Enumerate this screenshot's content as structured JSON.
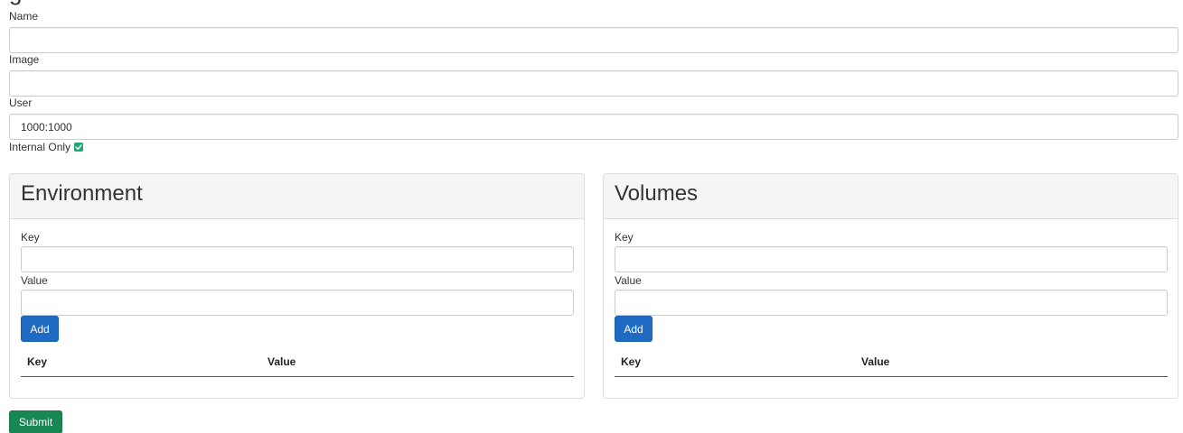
{
  "header": {
    "title": "g"
  },
  "form": {
    "name_label": "Name",
    "name_value": "",
    "image_label": "Image",
    "image_value": "",
    "user_label": "User",
    "user_value": "1000:1000",
    "internal_only_label": "Internal Only",
    "internal_only_checked": true
  },
  "environment": {
    "title": "Environment",
    "key_label": "Key",
    "key_value": "",
    "value_label": "Value",
    "value_value": "",
    "add_label": "Add",
    "columns": [
      "Key",
      "Value"
    ],
    "rows": []
  },
  "volumes": {
    "title": "Volumes",
    "key_label": "Key",
    "key_value": "",
    "value_label": "Value",
    "value_value": "",
    "add_label": "Add",
    "columns": [
      "Key",
      "Value"
    ],
    "rows": []
  },
  "submit_label": "Submit",
  "colors": {
    "primary": "#1f6bc4",
    "success": "#198754",
    "checkbox": "#1fa67a",
    "panel_heading_bg": "#f5f5f5",
    "border": "#cccccc"
  },
  "icons": {
    "checkbox": "checkmark-icon"
  }
}
